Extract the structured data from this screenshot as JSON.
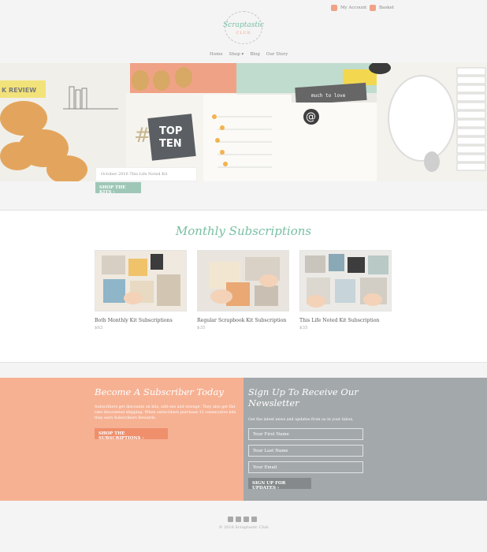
{
  "header": {
    "account_label": "My Account",
    "basket_label": "Basket",
    "logo_text": "Scraptastic",
    "logo_sub": "CLUB",
    "nav": [
      "Home",
      "Shop ▾",
      "Blog",
      "Our Story"
    ]
  },
  "hero": {
    "caption": "October 2016 This Life Noted Kit",
    "button": "SHOP THE KITS ›",
    "pieces": {
      "review": "K REVIEW",
      "topten_1": "TOP",
      "topten_2": "TEN",
      "hash": "#",
      "at": "@",
      "tape": "much to love"
    }
  },
  "subscriptions": {
    "title": "Monthly Subscriptions",
    "items": [
      {
        "name": "Both Monthly Kit Subscriptions",
        "price": "$63"
      },
      {
        "name": "Regular Scrapbook Kit Subscription",
        "price": "$35"
      },
      {
        "name": "This Life Noted Kit Subscription",
        "price": "$35"
      }
    ]
  },
  "subscriber": {
    "title": "Become A Subscriber Today",
    "text": "Subscribers get discounts on kits, add-ons and storage. They also get flat rate discounted shipping. When subscribers purchase 12 consecutive kits they earn Subscribers Rewards.",
    "button": "SHOP THE SUBSCRIPTIONS ›"
  },
  "newsletter": {
    "title": "Sign Up To Receive Our Newsletter",
    "text": "Get the latest news and updates from us in your inbox.",
    "first_name_placeholder": "Your First Name",
    "last_name_placeholder": "Your Last Name",
    "email_placeholder": "Your Email",
    "button": "SIGN UP FOR UPDATES ›"
  },
  "footer": {
    "social": [
      "facebook-icon",
      "twitter-icon",
      "instagram-icon",
      "pinterest-icon"
    ],
    "copyright": "© 2016 Scraptastic Club"
  },
  "colors": {
    "accent_green": "#78bfa3",
    "peach": "#f6b193",
    "gray_band": "#a3a8aa"
  }
}
